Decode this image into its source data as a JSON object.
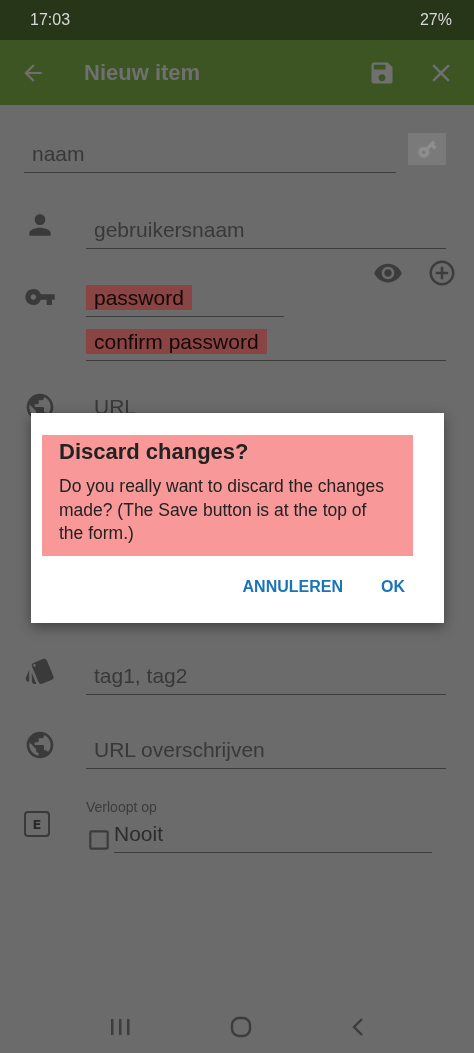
{
  "status_bar": {
    "time": "17:03",
    "battery": "27%"
  },
  "app_bar": {
    "title": "Nieuw item"
  },
  "form": {
    "name": {
      "placeholder": "naam"
    },
    "username": {
      "placeholder": "gebruikersnaam"
    },
    "password": {
      "placeholder": "password",
      "confirm_placeholder": "confirm password",
      "highlighted": true
    },
    "url": {
      "placeholder": "URL"
    },
    "tags": {
      "placeholder": "tag1, tag2"
    },
    "override_url": {
      "placeholder": "URL overschrijven"
    },
    "expires": {
      "icon_text": "E",
      "label": "Verloopt op",
      "checked": false,
      "placeholder": "Nooit"
    }
  },
  "dialog": {
    "title": "Discard changes?",
    "message": "Do you really want to discard the changes made? (The Save button is at the top of the form.)",
    "highlighted": true,
    "buttons": [
      "ANNULEREN",
      "OK"
    ]
  }
}
